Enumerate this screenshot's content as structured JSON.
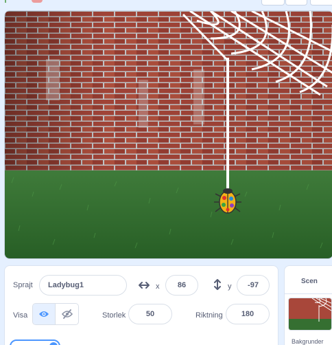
{
  "sprite_info": {
    "sprite_label": "Sprajt",
    "sprite_name": "Ladybug1",
    "x_label": "x",
    "x_value": "86",
    "y_label": "y",
    "y_value": "-97",
    "show_label": "Visa",
    "size_label": "Storlek",
    "size_value": "50",
    "direction_label": "Riktning",
    "direction_value": "180"
  },
  "stage_target": {
    "title": "Scen",
    "backdrops_label": "Bakgrunder"
  },
  "icons": {
    "flag": "green-flag-icon",
    "stop": "stop-icon",
    "show": "eye-icon",
    "hide": "eye-slash-icon",
    "x_axis": "horizontal-arrows-icon",
    "y_axis": "vertical-arrows-icon"
  },
  "colors": {
    "accent": "#4d97ff",
    "flag": "#4cbf56",
    "stop": "#ec5959",
    "text": "#575e75"
  }
}
